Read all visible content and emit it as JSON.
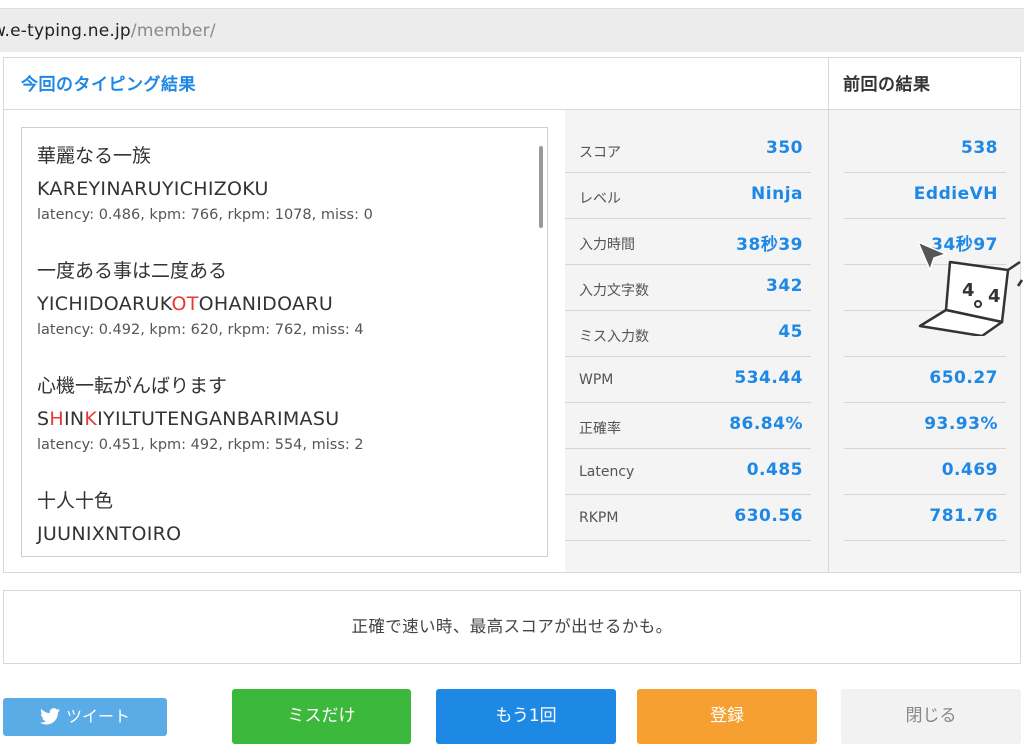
{
  "browser": {
    "url_host": "w.e-typing.ne.jp",
    "url_path": "/member/"
  },
  "result": {
    "current_header": "今回のタイピング結果",
    "previous_header": "前回の結果",
    "entries": [
      {
        "japanese": "華麗なる一族",
        "romaji_parts": [
          "KAREYINARUYICHIZOKU"
        ],
        "meta": "latency: 0.486, kpm: 766, rkpm: 1078, miss: 0"
      },
      {
        "japanese": "一度ある事は二度ある",
        "romaji_parts": [
          "YICHIDOARUK",
          "OT",
          "OHANIDOARU"
        ],
        "meta": "latency: 0.492, kpm: 620, rkpm: 762, miss: 4"
      },
      {
        "japanese": "心機一転がんばります",
        "romaji_parts": [
          "S",
          "H",
          "IN",
          "K",
          "IYILTUTENGANBARIMASU"
        ],
        "meta": "latency: 0.451, kpm: 492, rkpm: 554, miss: 2"
      },
      {
        "japanese": "十人十色",
        "romaji_parts": [
          "JUUNIXNTOIRO"
        ],
        "meta": ""
      }
    ],
    "stats": [
      {
        "label": "スコア",
        "current": "350",
        "previous": "538"
      },
      {
        "label": "レベル",
        "current": "Ninja",
        "previous": "EddieVH"
      },
      {
        "label": "入力時間",
        "current": "38秒39",
        "previous": "34秒97"
      },
      {
        "label": "入力文字数",
        "current": "342",
        "previous": ""
      },
      {
        "label": "ミス入力数",
        "current": "45",
        "previous": ""
      },
      {
        "label": "WPM",
        "current": "534.44",
        "previous": "650.27"
      },
      {
        "label": "正確率",
        "current": "86.84%",
        "previous": "93.93%"
      },
      {
        "label": "Latency",
        "current": "0.485",
        "previous": "0.469"
      },
      {
        "label": "RKPM",
        "current": "630.56",
        "previous": "781.76"
      }
    ]
  },
  "message": "正確で速い時、最高スコアが出せるかも。",
  "buttons": {
    "tweet": "ツイート",
    "miss_only": "ミスだけ",
    "again": "もう1回",
    "register": "登録",
    "close": "閉じる"
  },
  "icons": {
    "tweet": "bird-icon",
    "pointer": "cursor-arrow-icon",
    "mascot": "laptop-mascot-icon"
  },
  "colors": {
    "accent": "#1e88e5",
    "error": "#e53935",
    "green": "#3cb83c",
    "orange": "#f5a030",
    "twitter": "#5aace6"
  }
}
